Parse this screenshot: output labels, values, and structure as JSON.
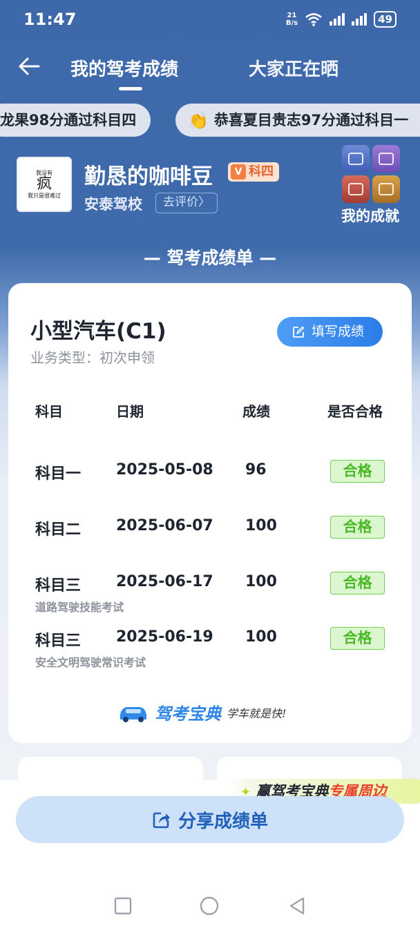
{
  "status_bar": {
    "time": "11:47",
    "net_speed_value": "21",
    "net_speed_unit": "B/s",
    "battery": "49"
  },
  "nav": {
    "back_icon": "arrow-left-icon",
    "tabs": [
      {
        "label": "我的驾考成绩",
        "active": true
      },
      {
        "label": "大家正在晒",
        "active": false
      }
    ]
  },
  "marquee": [
    {
      "text": "龙果98分通过科目四"
    },
    {
      "icon": "clap-icon",
      "text": "恭喜夏目贵志97分通过科目一"
    }
  ],
  "profile": {
    "avatar_big_text": "疯",
    "avatar_line1": "我没有",
    "avatar_line2": "我只是很难过",
    "username": "勤恳的咖啡豆",
    "badge_letter": "V",
    "badge_label": "科四",
    "school": "安泰驾校",
    "review_label": "去评价〉",
    "achievements_label": "我的成就"
  },
  "section_title": "— 驾考成绩单 —",
  "card": {
    "vehicle": "小型汽车(C1)",
    "business_type": "业务类型：初次申领",
    "fill_button": "填写成绩",
    "headers": {
      "subject": "科目",
      "date": "日期",
      "score": "成绩",
      "pass": "是否合格"
    },
    "rows": [
      {
        "subject": "科目一",
        "date": "2025-05-08",
        "score": "96",
        "pass": "合格",
        "sub": ""
      },
      {
        "subject": "科目二",
        "date": "2025-06-07",
        "score": "100",
        "pass": "合格",
        "sub": ""
      },
      {
        "subject": "科目三",
        "date": "2025-06-17",
        "score": "100",
        "pass": "合格",
        "sub": "道路驾驶技能考试"
      },
      {
        "subject": "科目三",
        "date": "2025-06-19",
        "score": "100",
        "pass": "合格",
        "sub": "安全文明驾驶常识考试"
      }
    ],
    "brand_name": "驾考宝典",
    "brand_slogan": "学车就是快!"
  },
  "promo": {
    "part1": "赢驾考宝典",
    "part2": "专属周边"
  },
  "share_button": "分享成绩单",
  "colors": {
    "header_blue": "#3d68a9",
    "accent_blue": "#2b7ce8",
    "pass_green": "#4bb825",
    "badge_orange": "#e3622d"
  }
}
